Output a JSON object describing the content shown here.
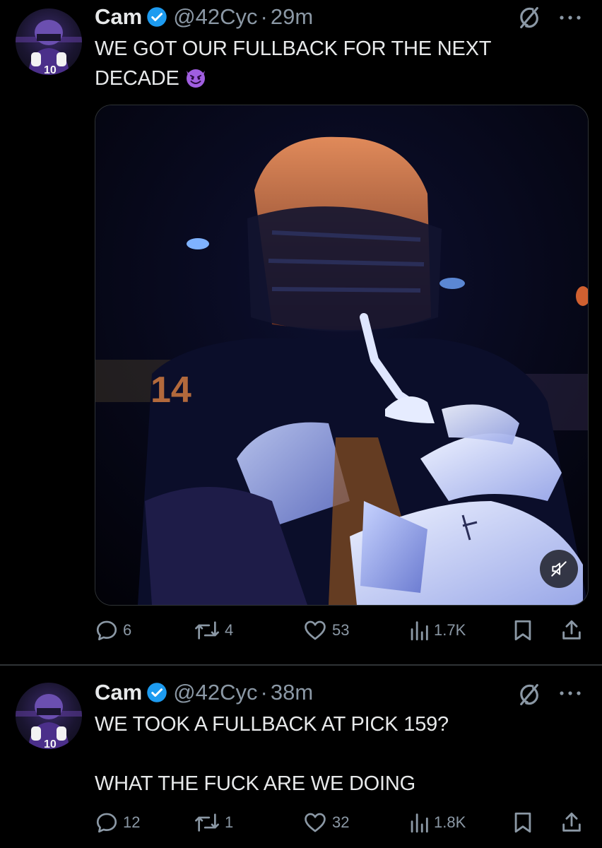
{
  "tweets": [
    {
      "author": {
        "name": "Cam",
        "handle": "@42Cyc",
        "verified": true
      },
      "separator": "·",
      "time": "29m",
      "text_lines": [
        "WE GOT OUR FULLBACK FOR THE NEXT",
        "DECADE"
      ],
      "emoji": "smiling-devil-emoji",
      "media": {
        "type": "video",
        "muted": true,
        "jersey_number": "14"
      },
      "stats": {
        "replies": "6",
        "reposts": "4",
        "likes": "53",
        "views": "1.7K"
      }
    },
    {
      "author": {
        "name": "Cam",
        "handle": "@42Cyc",
        "verified": true
      },
      "separator": "·",
      "time": "38m",
      "text_lines": [
        "WE TOOK A FULLBACK AT PICK 159?",
        "",
        "WHAT THE FUCK ARE WE DOING"
      ],
      "stats": {
        "replies": "12",
        "reposts": "1",
        "likes": "32",
        "views": "1.8K"
      }
    }
  ],
  "colors": {
    "background": "#000000",
    "text": "#e7e9ea",
    "secondary": "#8b98a5",
    "verified": "#1d9bf0",
    "divider": "#2f3336"
  }
}
